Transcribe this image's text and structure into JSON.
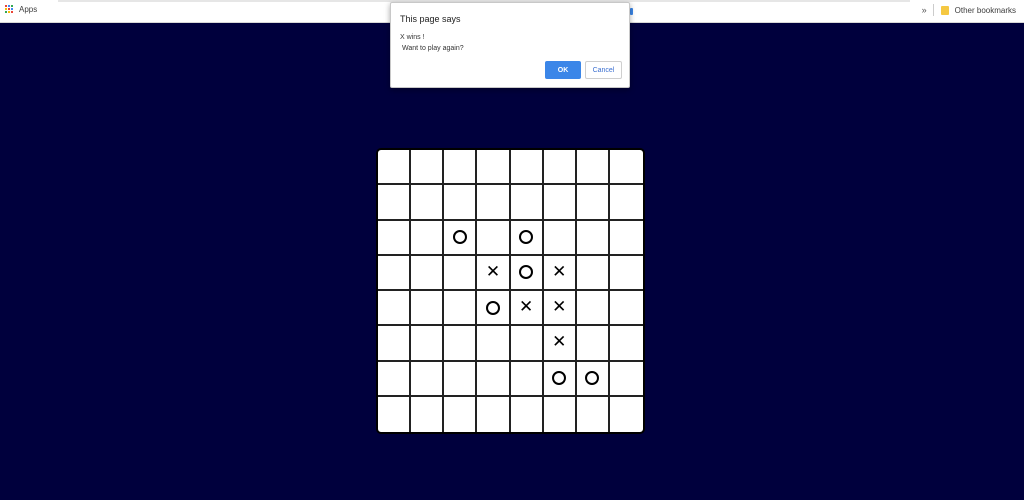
{
  "bookmarks_bar": {
    "apps_label": "Apps",
    "overflow_chevron": "»",
    "other_bookmarks_label": "Other bookmarks",
    "apps_grid_colors": [
      "#ea4335",
      "#4285f4",
      "#34a853",
      "#fbbc05",
      "#ea4335",
      "#4285f4",
      "#34a853",
      "#fbbc05",
      "#ea4335"
    ]
  },
  "dialog": {
    "title": "This page says",
    "message_line1": "X wins !",
    "message_line2": "Want to play again?",
    "ok_label": "OK",
    "cancel_label": "Cancel"
  },
  "board": {
    "rows": 8,
    "cols": 8,
    "cells": [
      [
        "",
        "",
        "",
        "",
        "",
        "",
        "",
        ""
      ],
      [
        "",
        "",
        "",
        "",
        "",
        "",
        "",
        ""
      ],
      [
        "",
        "",
        "O",
        "",
        "O",
        "",
        "",
        ""
      ],
      [
        "",
        "",
        "",
        "X",
        "O",
        "X",
        "",
        ""
      ],
      [
        "",
        "",
        "",
        "O",
        "X",
        "X",
        "",
        ""
      ],
      [
        "",
        "",
        "",
        "",
        "",
        "X",
        "",
        ""
      ],
      [
        "",
        "",
        "",
        "",
        "",
        "O",
        "O",
        ""
      ],
      [
        "",
        "",
        "",
        "",
        "",
        "",
        "",
        ""
      ]
    ]
  },
  "colors": {
    "page_background": "#00003d",
    "ok_button": "#3b86e8"
  }
}
